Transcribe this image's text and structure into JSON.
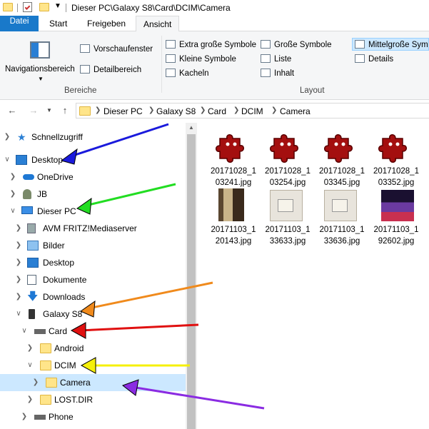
{
  "window": {
    "title": "Dieser PC\\Galaxy S8\\Card\\DCIM\\Camera"
  },
  "tabs": [
    {
      "label": "Datei"
    },
    {
      "label": "Start"
    },
    {
      "label": "Freigeben"
    },
    {
      "label": "Ansicht"
    }
  ],
  "ribbon": {
    "nav_pane": "Navigationsbereich",
    "preview_pane": "Vorschaufenster",
    "details_pane": "Detailbereich",
    "group_panes": "Bereiche",
    "layout": [
      "Extra große Symbole",
      "Große Symbole",
      "Mittelgroße Sym",
      "Kleine Symbole",
      "Liste",
      "Details",
      "Kacheln",
      "Inhalt"
    ],
    "group_layout": "Layout"
  },
  "address": {
    "crumbs": [
      "Dieser PC",
      "Galaxy S8",
      "Card",
      "DCIM",
      "Camera"
    ]
  },
  "tree": [
    {
      "label": "Schnellzugriff"
    },
    {
      "label": "Desktop"
    },
    {
      "label": "OneDrive"
    },
    {
      "label": "JB"
    },
    {
      "label": "Dieser PC"
    },
    {
      "label": "AVM FRITZ!Mediaserver"
    },
    {
      "label": "Bilder"
    },
    {
      "label": "Desktop"
    },
    {
      "label": "Dokumente"
    },
    {
      "label": "Downloads"
    },
    {
      "label": "Galaxy S8"
    },
    {
      "label": "Card"
    },
    {
      "label": "Android"
    },
    {
      "label": "DCIM"
    },
    {
      "label": "Camera"
    },
    {
      "label": "LOST.DIR"
    },
    {
      "label": "Phone"
    }
  ],
  "files": [
    {
      "name1": "20171028_1",
      "name2": "03241.jpg",
      "kind": "puzzle"
    },
    {
      "name1": "20171028_1",
      "name2": "03254.jpg",
      "kind": "puzzle"
    },
    {
      "name1": "20171028_1",
      "name2": "03345.jpg",
      "kind": "puzzle"
    },
    {
      "name1": "20171028_1",
      "name2": "03352.jpg",
      "kind": "puzzle"
    },
    {
      "name1": "20171103_1",
      "name2": "20143.jpg",
      "kind": "photo"
    },
    {
      "name1": "20171103_1",
      "name2": "33633.jpg",
      "kind": "photo"
    },
    {
      "name1": "20171103_1",
      "name2": "33636.jpg",
      "kind": "photo"
    },
    {
      "name1": "20171103_1",
      "name2": "92602.jpg",
      "kind": "photo"
    }
  ],
  "colors": {
    "accent": "#1979ca",
    "selection": "#cce8ff",
    "puzzle": "#a40f0f",
    "arrow_blue": "#1a1adc",
    "arrow_green": "#22dd22",
    "arrow_orange": "#f08a1c",
    "arrow_red": "#e01010",
    "arrow_yellow": "#f5f00a",
    "arrow_purple": "#8a2be2"
  }
}
